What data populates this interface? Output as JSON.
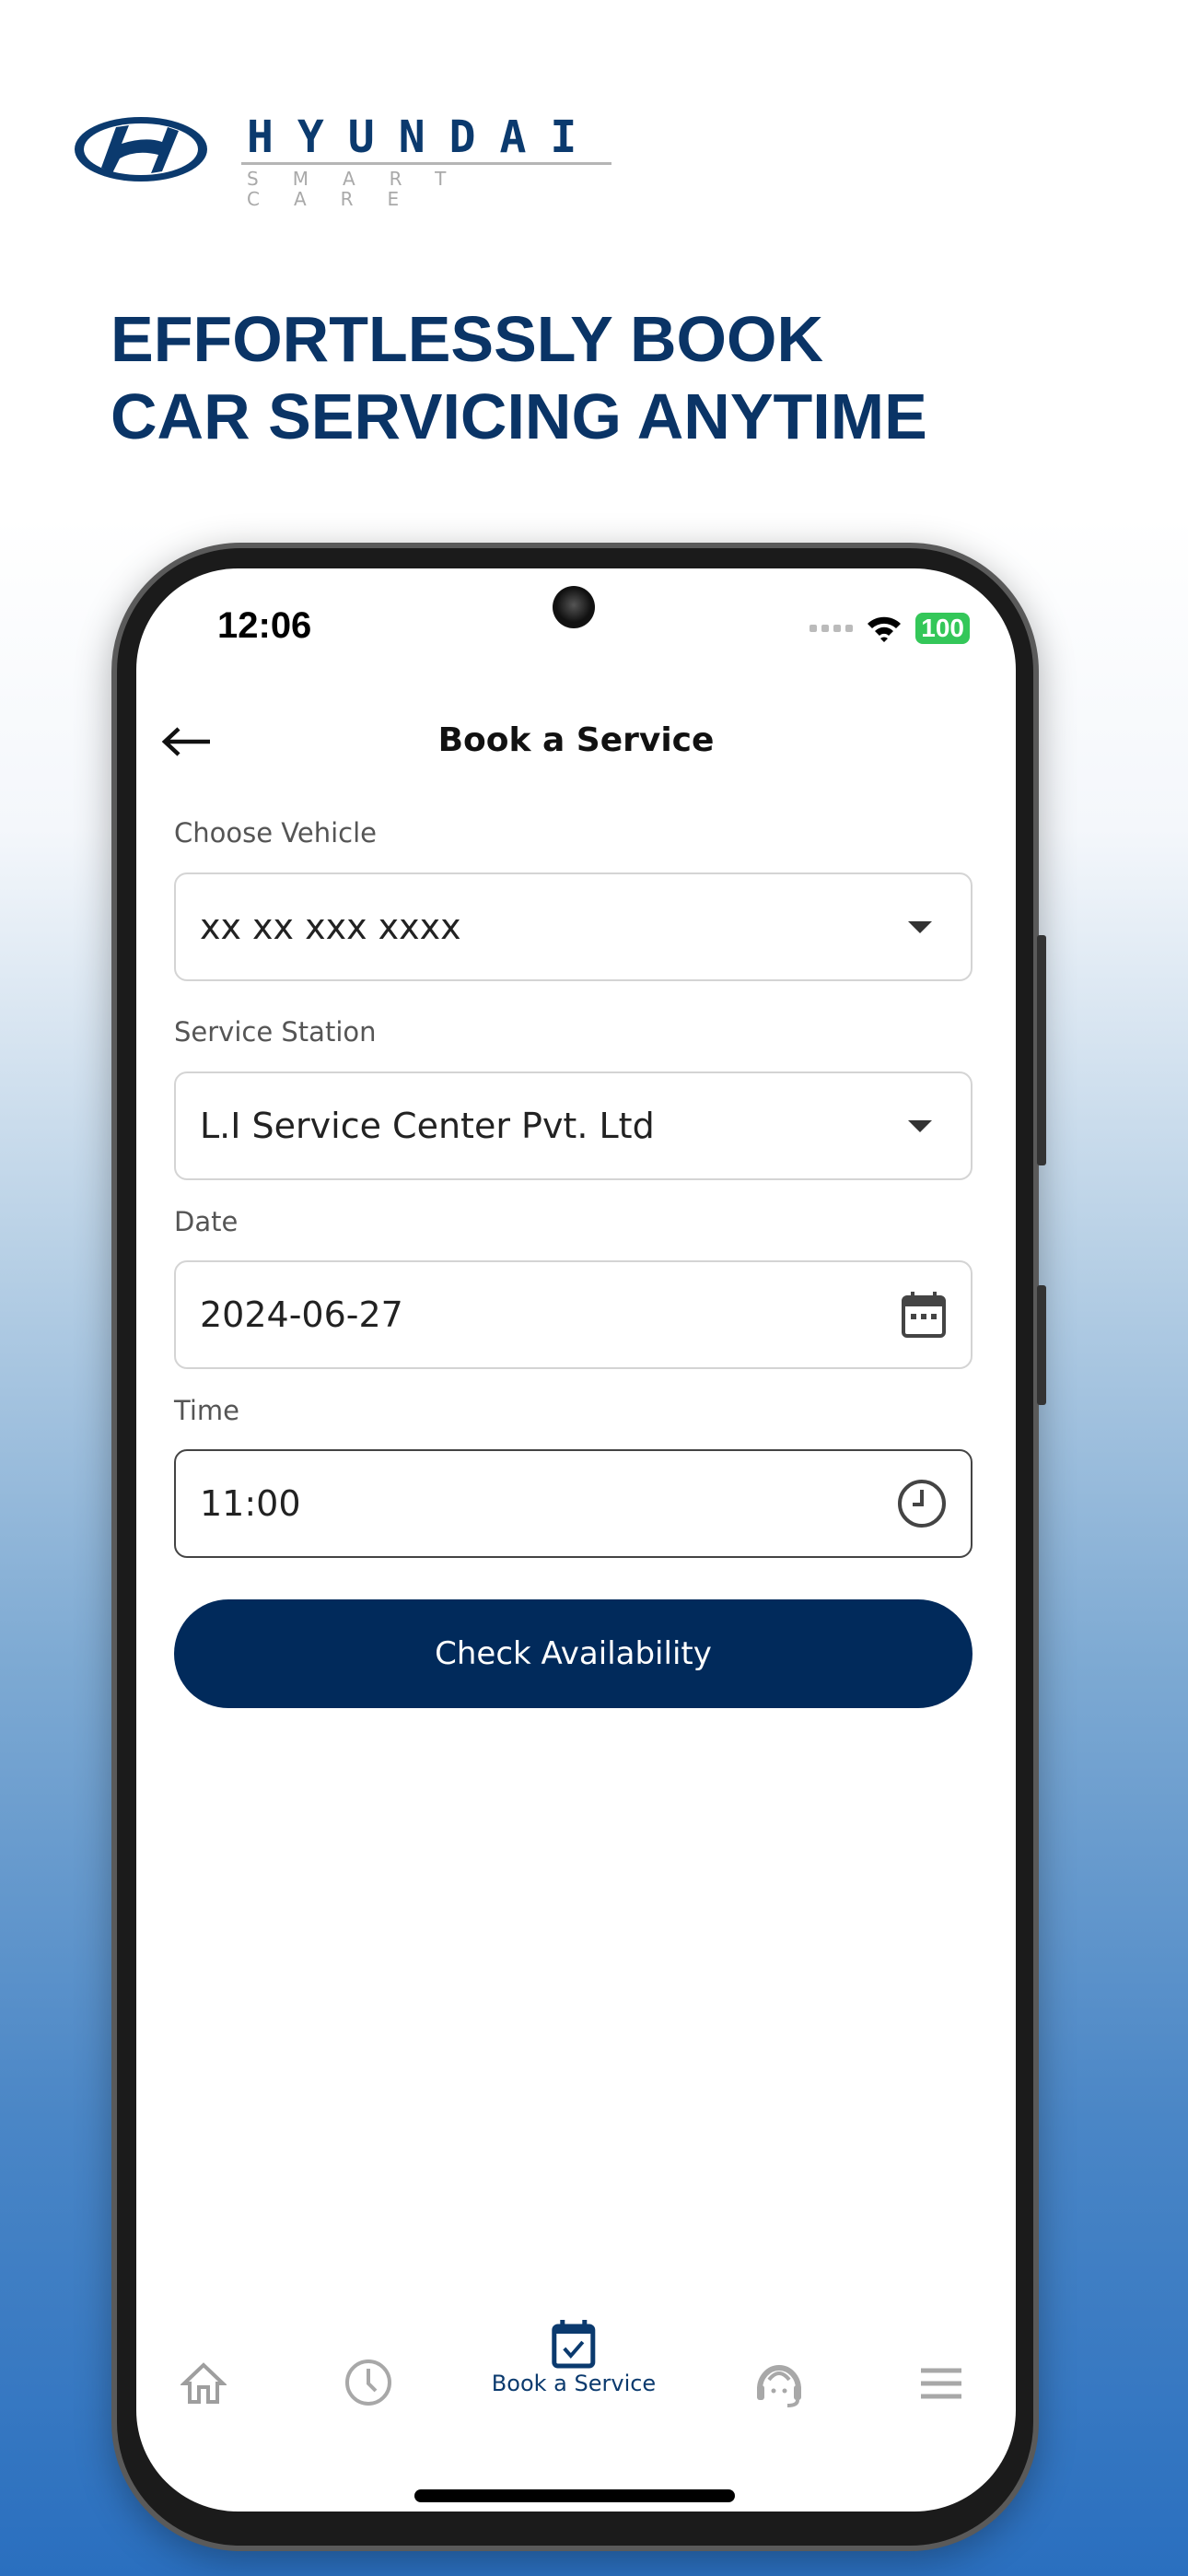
{
  "brand": {
    "wordmark": "HYUNDAI",
    "tagline": "SMART CARE",
    "color": "#0b3a6e"
  },
  "headline": {
    "line1": "EFFORTLESSLY BOOK",
    "line2": "CAR SERVICING ANYTIME"
  },
  "status_bar": {
    "time": "12:06",
    "battery": "100",
    "battery_color": "#34c759"
  },
  "header": {
    "title": "Book a Service",
    "back_icon": "arrow-left-icon"
  },
  "form": {
    "vehicle": {
      "label": "Choose Vehicle",
      "value": "xx xx xxx xxxx"
    },
    "station": {
      "label": "Service Station",
      "value": "L.I Service Center Pvt. Ltd"
    },
    "date": {
      "label": "Date",
      "value": "2024-06-27"
    },
    "time": {
      "label": "Time",
      "value": "11:00"
    },
    "submit_label": "Check Availability",
    "accent": "#012a5b"
  },
  "bottom_nav": {
    "items": [
      {
        "icon": "home-icon"
      },
      {
        "icon": "history-clock-icon"
      },
      {
        "icon": "calendar-check-icon",
        "label": "Book a Service",
        "active": true
      },
      {
        "icon": "support-agent-icon"
      },
      {
        "icon": "menu-icon"
      }
    ]
  }
}
